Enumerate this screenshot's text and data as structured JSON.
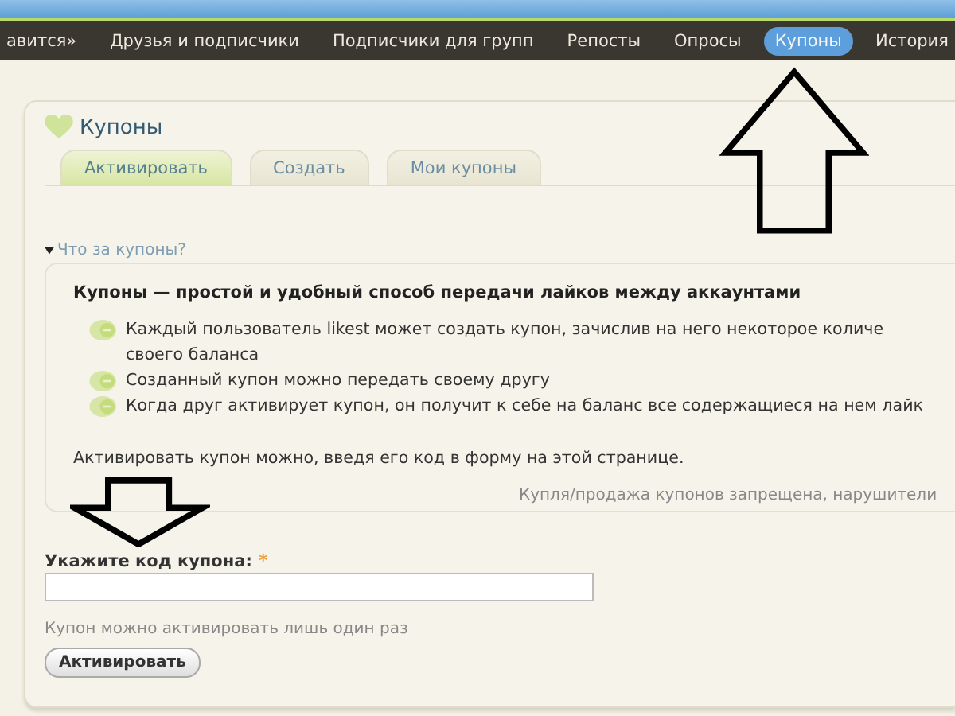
{
  "nav": [
    {
      "label": "авится»",
      "selected": false
    },
    {
      "label": "Друзья и подписчики",
      "selected": false
    },
    {
      "label": "Подписчики для групп",
      "selected": false
    },
    {
      "label": "Репосты",
      "selected": false
    },
    {
      "label": "Опросы",
      "selected": false
    },
    {
      "label": "Купоны",
      "selected": true
    },
    {
      "label": "История",
      "selected": false
    }
  ],
  "page_title": "Купоны",
  "tabs": [
    {
      "label": "Активировать",
      "selected": true
    },
    {
      "label": "Создать",
      "selected": false
    },
    {
      "label": "Мои купоны",
      "selected": false
    }
  ],
  "info": {
    "toggle": "Что за купоны?",
    "expanded": true,
    "heading": "Купоны — простой и удобный способ передачи лайков между аккаунтами",
    "bullets": [
      [
        "Каждый пользователь likest может создать купон, зачислив на него некоторое количе",
        "своего баланса"
      ],
      [
        "Созданный купон можно передать своему другу"
      ],
      [
        "Когда друг активирует купон, он получит к себе на баланс все содержащиеся на нем лайк"
      ]
    ],
    "paragraph": "Активировать купон можно, введя его код в форму на этой странице.",
    "note": "Купля/продажа купонов запрещена, нарушители"
  },
  "form": {
    "label": "Укажите код купона:",
    "required_mark": "*",
    "hint": "Купон можно активировать лишь один раз",
    "button": "Активировать"
  }
}
